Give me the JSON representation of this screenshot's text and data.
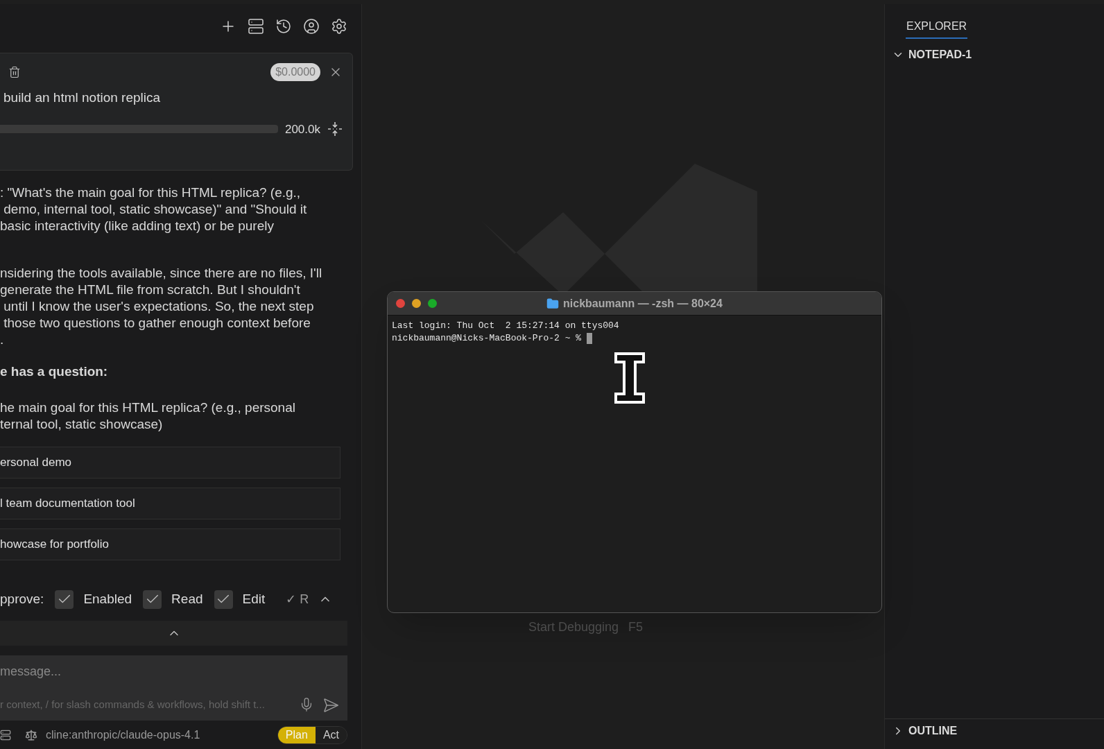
{
  "chat_panel": {
    "header_icons": [
      {
        "kind": "new-task"
      },
      {
        "kind": "servers"
      },
      {
        "kind": "history"
      },
      {
        "kind": "account"
      },
      {
        "kind": "settings"
      }
    ],
    "task": {
      "cost": "$0.0000",
      "title": "build an html notion replica",
      "context_limit": "200.0k"
    },
    "paragraphs": [
      [
        ": \"What's the main goal for this HTML replica? (e.g.,",
        " demo, internal tool, static showcase)\" and \"Should it",
        "basic interactivity (like adding text) or be purely"
      ],
      [
        "nsidering the tools available, since there are no files, I'll",
        "generate the HTML file from scratch. But I shouldn't",
        " until I know the user's expectations. So, the next step",
        " those two questions to gather enough context before",
        "."
      ]
    ],
    "question_heading": "e has a question:",
    "question": [
      "he main goal for this HTML replica? (e.g., personal",
      "ternal tool, static showcase)"
    ],
    "options": [
      "ersonal demo",
      "l team documentation tool",
      "howcase for portfolio"
    ],
    "auto_approve": {
      "label": "pprove:",
      "items": [
        {
          "label": "Enabled",
          "checked": true
        },
        {
          "label": "Read",
          "checked": true
        },
        {
          "label": "Edit",
          "checked": true
        }
      ],
      "summary": "✓ R",
      "expanded": false
    },
    "input": {
      "placeholder": "message...",
      "hint": "r context, / for slash commands & workflows, hold shift t..."
    },
    "model": "cline:anthropic/claude-opus-4.1",
    "modes": [
      {
        "label": "Plan",
        "selected": true
      },
      {
        "label": "Act",
        "selected": false
      }
    ]
  },
  "editor": {
    "hint_label": "Start Debugging",
    "hint_key": "F5"
  },
  "terminal": {
    "title": "nickbaumann — -zsh — 80×24",
    "lines": [
      "Last login: Thu Oct  2 15:27:14 on ttys004"
    ],
    "prompt": "nickbaumann@Nicks-MacBook-Pro-2 ~ %"
  },
  "sidebar": {
    "tabs": [
      {
        "label": "EXPLORER",
        "selected": true
      }
    ],
    "sections": [
      {
        "label": "NOTEPAD-1",
        "expanded": true
      },
      {
        "label": "OUTLINE",
        "expanded": false
      }
    ]
  }
}
